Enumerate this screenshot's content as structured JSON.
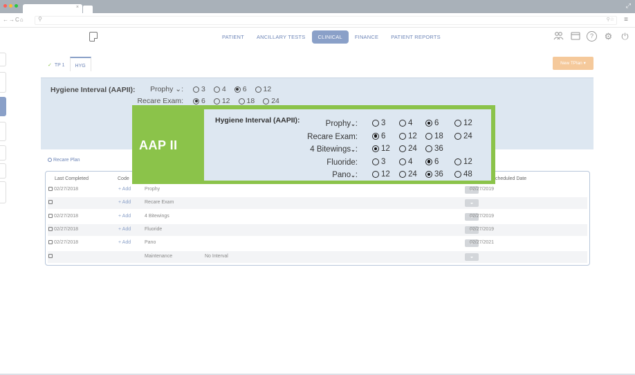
{
  "nav": {
    "tabs": [
      "PATIENT",
      "ANCILLARY TESTS",
      "CLINICAL",
      "FINANCE",
      "PATIENT REPORTS"
    ],
    "active": "CLINICAL"
  },
  "subtabs": {
    "tp1": "TP 1",
    "hyg": "HYG"
  },
  "new_tplan": "New TPlan ▾",
  "panel": {
    "title": "Hygiene Interval (AAPII):",
    "prophy_label": "Prophy ⌄:",
    "prophy_opts": [
      "3",
      "4",
      "6",
      "12"
    ],
    "prophy_selected": "6",
    "recare_label": "Recare Exam:",
    "recare_opts": [
      "6",
      "12",
      "18",
      "24"
    ],
    "recare_selected": "6"
  },
  "overlay": {
    "label": "AAP II",
    "title": "Hygiene Interval (AAPII):",
    "rows": [
      {
        "label": "Prophy",
        "chevron": true,
        "opts": [
          "3",
          "4",
          "6",
          "12"
        ],
        "selected": "6"
      },
      {
        "label": "Recare Exam:",
        "chevron": false,
        "opts": [
          "6",
          "12",
          "18",
          "24"
        ],
        "selected": "6"
      },
      {
        "label": "4 Bitewings",
        "chevron": true,
        "opts": [
          "12",
          "24",
          "36"
        ],
        "selected": "12"
      },
      {
        "label": "Fluoride:",
        "chevron": false,
        "opts": [
          "3",
          "4",
          "6",
          "12"
        ],
        "selected": "6"
      },
      {
        "label": "Pano",
        "chevron": true,
        "opts": [
          "12",
          "24",
          "36",
          "48"
        ],
        "selected": "36"
      }
    ]
  },
  "recare_plan": "Recare Plan",
  "table": {
    "headers": {
      "last": "Last Completed",
      "code": "Code",
      "scheduled": "cheduled Date"
    },
    "rows": [
      {
        "last": "02/27/2018",
        "add": "+ Add",
        "name": "Prophy",
        "interval": "",
        "scheduled": "02/27/2019"
      },
      {
        "last": "",
        "add": "+ Add",
        "name": "Recare Exam",
        "interval": "",
        "scheduled": ""
      },
      {
        "last": "02/27/2018",
        "add": "+ Add",
        "name": "4 Bitewings",
        "interval": "",
        "scheduled": "02/27/2019"
      },
      {
        "last": "02/27/2018",
        "add": "+ Add",
        "name": "Fluoride",
        "interval": "",
        "scheduled": "02/27/2019"
      },
      {
        "last": "02/27/2018",
        "add": "+ Add",
        "name": "Pano",
        "interval": "",
        "scheduled": "02/27/2021"
      },
      {
        "last": "",
        "add": "",
        "name": "Maintenance",
        "interval": "No Interval",
        "scheduled": ""
      }
    ]
  },
  "colors": {
    "accent": "#8aa0c8",
    "overlay_green": "#8bc34a",
    "panel_bg": "#dde7f1",
    "new_btn": "#f5c99b"
  }
}
